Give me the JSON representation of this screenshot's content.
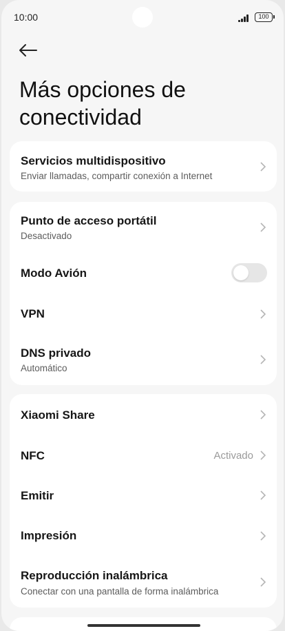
{
  "status_bar": {
    "time": "10:00",
    "battery": "100"
  },
  "header": {
    "title": "Más opciones de conectividad"
  },
  "groups": [
    {
      "items": [
        {
          "title": "Servicios multidispositivo",
          "subtitle": "Enviar llamadas, compartir conexión a Internet"
        }
      ]
    },
    {
      "items": [
        {
          "title": "Punto de acceso portátil",
          "subtitle": "Desactivado"
        },
        {
          "title": "Modo Avión",
          "toggle_on": false
        },
        {
          "title": "VPN"
        },
        {
          "title": "DNS privado",
          "subtitle": "Automático"
        }
      ]
    },
    {
      "items": [
        {
          "title": "Xiaomi Share"
        },
        {
          "title": "NFC",
          "value": "Activado"
        },
        {
          "title": "Emitir"
        },
        {
          "title": "Impresión"
        },
        {
          "title": "Reproducción inalámbrica",
          "subtitle": "Conectar con una pantalla de forma inalámbrica"
        }
      ]
    }
  ],
  "colors": {
    "background": "#f6f6f6",
    "card": "#ffffff",
    "toggle_off": "#e6e6e6"
  },
  "icons": [
    "back-arrow-icon",
    "chevron-right-icon",
    "signal-icon",
    "battery-icon"
  ]
}
